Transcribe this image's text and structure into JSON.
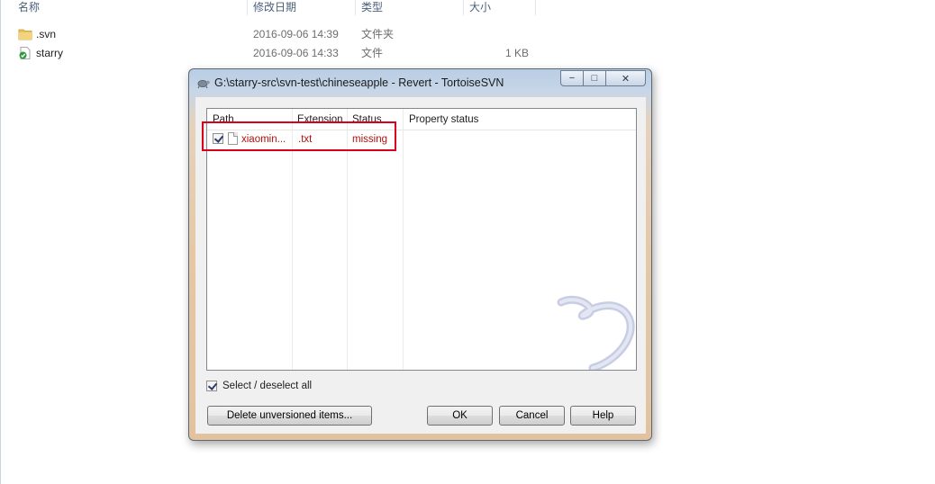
{
  "explorer": {
    "columns": {
      "name": "名称",
      "date": "修改日期",
      "type": "类型",
      "size": "大小"
    },
    "rows": [
      {
        "name": ".svn",
        "date": "2016-09-06 14:39",
        "type": "文件夹",
        "size": "",
        "icon": "folder-icon"
      },
      {
        "name": "starry",
        "date": "2016-09-06 14:33",
        "type": "文件",
        "size": "1 KB",
        "icon": "svn-normal-file-icon"
      }
    ]
  },
  "dialog": {
    "title": "G:\\starry-src\\svn-test\\chineseapple - Revert - TortoiseSVN",
    "window_buttons": {
      "minimize": "−",
      "maximize": "□",
      "close": "✕"
    },
    "list": {
      "headers": {
        "path": "Path",
        "extension": "Extension",
        "status": "Status",
        "property_status": "Property status"
      },
      "rows": [
        {
          "checked": true,
          "path": "xiaomin...",
          "extension": ".txt",
          "status": "missing",
          "property_status": ""
        }
      ]
    },
    "select_all": {
      "label": "Select / deselect all",
      "checked": true
    },
    "buttons": {
      "delete_unversioned": "Delete unversioned items...",
      "ok": "OK",
      "cancel": "Cancel",
      "help": "Help"
    }
  },
  "colors": {
    "highlight_box": "#d9001b",
    "status_text": "#b01010"
  }
}
